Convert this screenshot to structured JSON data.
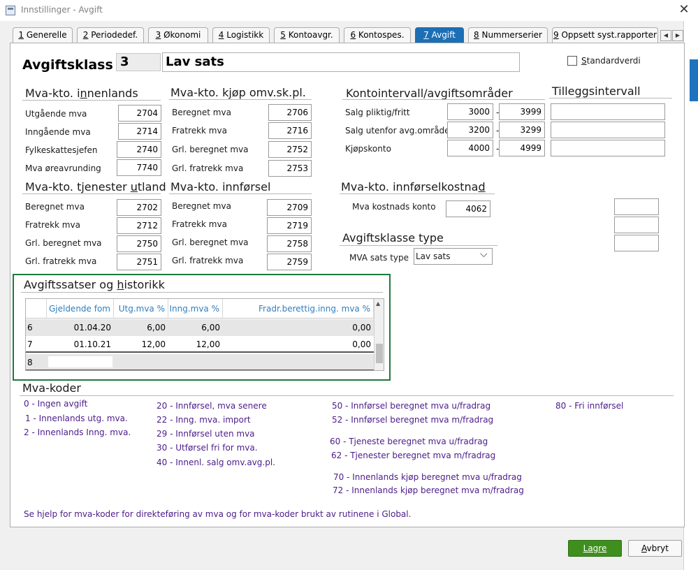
{
  "window": {
    "title": "Innstillinger - Avgift",
    "close_glyph": "✕"
  },
  "tabs": [
    {
      "key": "1",
      "label": " Generelle"
    },
    {
      "key": "2",
      "label": " Periodedef."
    },
    {
      "key": "3",
      "label": " Økonomi"
    },
    {
      "key": "4",
      "label": " Logistikk"
    },
    {
      "key": "5",
      "label": " Kontoavgr."
    },
    {
      "key": "6",
      "label": " Kontospes."
    },
    {
      "key": "7",
      "label": " Avgift"
    },
    {
      "key": "8",
      "label": " Nummerserier"
    },
    {
      "key": "9",
      "label": " Oppsett syst.rapporter"
    }
  ],
  "tab_scroll": {
    "left": "◀",
    "right": "▶"
  },
  "header": {
    "label": "Avgiftsklass",
    "code": "3",
    "name": "Lav sats",
    "standard_label": "Standardverdi"
  },
  "innenlands": {
    "title_a": "Mva-kto. i",
    "title_u": "n",
    "title_b": "nenlands",
    "rows": [
      {
        "label": "Utgående mva",
        "value": "2704"
      },
      {
        "label": "Inngående mva",
        "value": "2714"
      },
      {
        "label": "Fylkeskattesjefen",
        "value": "2740"
      },
      {
        "label": "Mva øreavrunding",
        "value": "7740"
      }
    ]
  },
  "kjop": {
    "title_a": "Mva-kto. k",
    "title_u": "j",
    "title_b": "øp omv.sk.pl.",
    "rows": [
      {
        "label": "Beregnet mva",
        "value": "2706"
      },
      {
        "label": "Fratrekk mva",
        "value": "2716"
      },
      {
        "label": "Grl. beregnet mva",
        "value": "2752"
      },
      {
        "label": "Grl. fratrekk mva",
        "value": "2753"
      }
    ]
  },
  "tjenester": {
    "title_a": "Mva-kto. tjenester ",
    "title_u": "u",
    "title_b": "tland",
    "rows": [
      {
        "label": "Beregnet mva",
        "value": "2702"
      },
      {
        "label": "Fratrekk mva",
        "value": "2712"
      },
      {
        "label": "Grl. beregnet mva",
        "value": "2750"
      },
      {
        "label": "Grl. fratrekk mva",
        "value": "2751"
      }
    ]
  },
  "innforsel": {
    "title": "Mva-kto. innførsel",
    "rows": [
      {
        "label": "Beregnet mva",
        "value": "2709"
      },
      {
        "label": "Fratrekk mva",
        "value": "2719"
      },
      {
        "label": "Grl. beregnet mva",
        "value": "2758"
      },
      {
        "label": "Grl. fratrekk mva",
        "value": "2759"
      }
    ]
  },
  "kontointervall": {
    "title": "Kontointervall/avgiftsområder",
    "rows": [
      {
        "label": "Salg pliktig/fritt",
        "from": "3000",
        "to": "3999"
      },
      {
        "label": "Salg utenfor avg.område",
        "from": "3200",
        "to": "3299"
      },
      {
        "label": "Kjøpskonto",
        "from": "4000",
        "to": "4999"
      }
    ],
    "dash": "-"
  },
  "tillegg": {
    "title": "Tilleggsintervall"
  },
  "kostnad": {
    "title_a": "Mva-kto. innførselkostna",
    "title_u": "d",
    "label": "Mva kostnads konto",
    "value": "4062"
  },
  "klassetype": {
    "title": "Avgiftsklasse type",
    "label": "MVA sats type",
    "selected": "Lav sats",
    "chevron": "⌵"
  },
  "historikk": {
    "title_a": "Avgiftssatser og ",
    "title_u": "h",
    "title_b": "istorikk",
    "columns": [
      "Gjeldende fom",
      "Utg.mva %",
      "Inng.mva %",
      "Fradr.berettig.inng. mva %"
    ],
    "rows": [
      {
        "n": "6",
        "fom": "01.04.20",
        "utg": "6,00",
        "inng": "6,00",
        "fradr": "0,00"
      },
      {
        "n": "7",
        "fom": "01.10.21",
        "utg": "12,00",
        "inng": "12,00",
        "fradr": "0,00"
      },
      {
        "n": "8",
        "fom": "",
        "utg": "",
        "inng": "",
        "fradr": ""
      }
    ],
    "scroll_up": "▲"
  },
  "mvakoder": {
    "title": "Mva-koder",
    "col1": [
      "0 - Ingen avgift",
      "1 - Innenlands utg. mva.",
      "2 - Innenlands Inng. mva."
    ],
    "col2": [
      "20 - Innførsel, mva senere",
      "22 - Inng. mva. import",
      "29 - Innførsel uten mva",
      "30 - Utførsel fri for mva.",
      "40 - Innenl. salg omv.avg.pl."
    ],
    "col3a": [
      "50 - Innførsel beregnet mva u/fradrag",
      "52 - Innførsel beregnet mva m/fradrag"
    ],
    "col3b": [
      "60 - Tjeneste beregnet mva u/fradrag",
      "62 - Tjenester beregnet mva m/fradrag"
    ],
    "col3c": [
      "70 - Innenlands kjøp beregnet mva u/fradrag",
      "72 - Innenlands kjøp beregnet mva  m/fradrag"
    ],
    "col4": [
      "80 - Fri innførsel"
    ],
    "note": "Se hjelp for mva-koder for direkteføring av mva og for mva-koder brukt av rutinene i Global."
  },
  "buttons": {
    "save": "Lagre",
    "cancel_a": "",
    "cancel_u": "A",
    "cancel_b": "vbryt"
  },
  "colors": {
    "accent": "#1c6fb5",
    "save_green": "#3f8f1e",
    "history_border": "#1e7a3c",
    "mva_code": "#4b1c8a",
    "grid_header": "#2f7fc0"
  }
}
